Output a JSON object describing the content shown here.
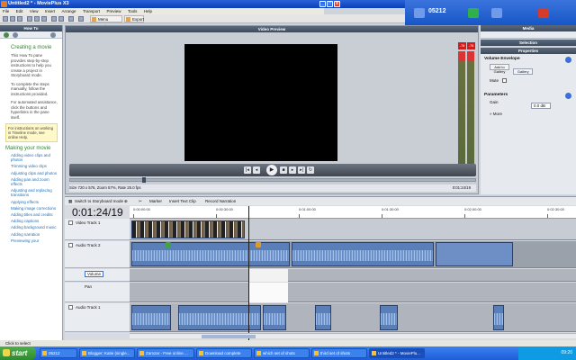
{
  "window": {
    "title": "Untitled2 * - MoviePlus X3"
  },
  "menu": [
    "File",
    "Edit",
    "View",
    "Insert",
    "Arrange",
    "Transport",
    "Preview",
    "Tools",
    "Help"
  ],
  "toolbar": {
    "menu_designer": "Menu Designer",
    "export": "Export"
  },
  "tray": {
    "user": "05212"
  },
  "howto": {
    "title": "How To",
    "heading": "Creating a movie",
    "p1": "This How To pane provides step-by-step instructions to help you create a project in Storyboard mode.",
    "p2": "To complete the steps manually, follow the instructions provided.",
    "p3": "For automated assistance, click the buttons and hyperlinks in the pane itself.",
    "note": "For instructions on working in Timeline mode, see online Help.",
    "making": "Making your movie",
    "links": [
      "Adding video clips and photos",
      "Trimming video clips",
      "Adjusting clips and photos",
      "Adding pan and zoom effects",
      "Adjusting and replacing transitions",
      "Applying effects",
      "Making image corrections",
      "Adding titles and credits",
      "Adding captions",
      "Adding background music",
      "Adding narration",
      "Previewing your"
    ]
  },
  "preview": {
    "title": "Video Preview",
    "info": "Size 720 x 576, Zoom 57%, Rate 25.0 fps",
    "timecode": "0:01:24/19",
    "meter_left": "-78",
    "meter_right": "-78"
  },
  "right": {
    "media": "Media",
    "selection": "Selection",
    "properties": "Properties",
    "volume_title": "Volume Envelope",
    "add_gallery": "Add to Gallery",
    "gallery": "Gallery",
    "mute": "Mute",
    "parameters": "Parameters",
    "gain_label": "Gain",
    "gain_value": "0.0 dB",
    "more": "More"
  },
  "timeline": {
    "switch_label": "Switch to Storyboard mode",
    "marker": "Marker",
    "insert_text": "Insert Text Clip",
    "record": "Record Narration",
    "timecode": "0:01:24/19",
    "ruler": [
      "0:00:00:00",
      "0:00:30:00",
      "0:01:00:00",
      "0:01:30:00",
      "0:02:00:00",
      "0:02:30:00"
    ],
    "tracks": [
      {
        "name": "Video Track 1"
      },
      {
        "name": "Audio Track 2"
      },
      {
        "name": "Volume"
      },
      {
        "name": "Pan"
      },
      {
        "name": "Audio Track 1"
      }
    ]
  },
  "status": "Click to select",
  "taskbar": {
    "start": "start",
    "tasks": [
      "05212",
      "Blogger: Katie (single...",
      "Zamzar - Free online ...",
      "Download complete",
      "which set of shots",
      "third set of shots",
      "Untitled2 * - MoviePlu..."
    ],
    "clock": "09:20"
  }
}
